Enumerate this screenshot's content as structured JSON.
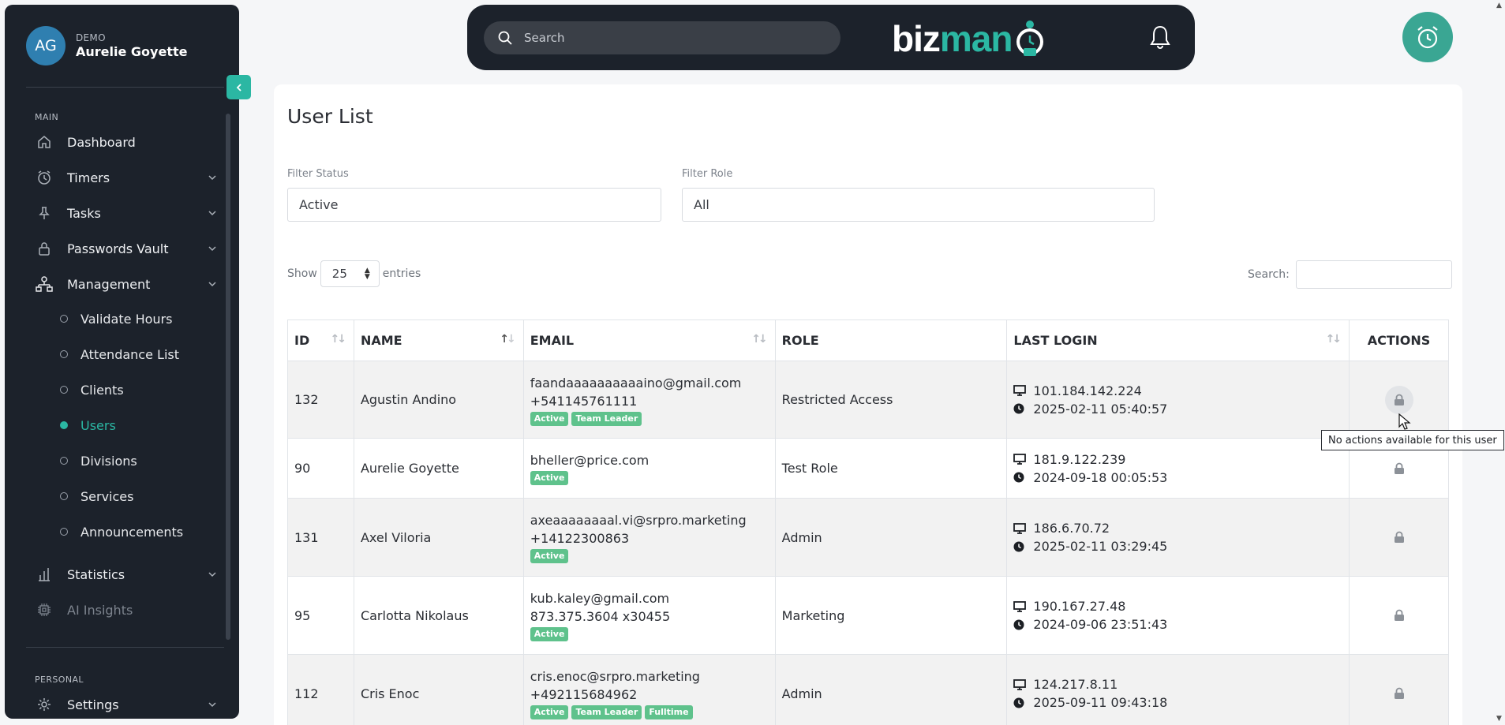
{
  "profile": {
    "initials": "AG",
    "role": "DEMO",
    "name": "Aurelie Goyette"
  },
  "sidebar": {
    "main_label": "MAIN",
    "personal_label": "PERSONAL",
    "items": [
      {
        "label": "Dashboard",
        "icon": "home-icon"
      },
      {
        "label": "Timers",
        "icon": "timer-icon"
      },
      {
        "label": "Tasks",
        "icon": "pin-icon"
      },
      {
        "label": "Passwords Vault",
        "icon": "lock-icon"
      },
      {
        "label": "Management",
        "icon": "org-chart-icon"
      },
      {
        "label": "Statistics",
        "icon": "bar-chart-icon"
      },
      {
        "label": "AI Insights",
        "icon": "chip-icon"
      },
      {
        "label": "Settings",
        "icon": "gear-icon"
      }
    ],
    "management_sub": [
      {
        "label": "Validate Hours"
      },
      {
        "label": "Attendance List"
      },
      {
        "label": "Clients"
      },
      {
        "label": "Users",
        "active": true
      },
      {
        "label": "Divisions"
      },
      {
        "label": "Services"
      },
      {
        "label": "Announcements"
      }
    ]
  },
  "topbar": {
    "search_placeholder": "Search",
    "logo_biz": "biz",
    "logo_man": "man"
  },
  "page": {
    "title": "User List",
    "filter_status_label": "Filter Status",
    "filter_status_value": "Active",
    "filter_role_label": "Filter Role",
    "filter_role_value": "All",
    "show_label": "Show",
    "entries_value": "25",
    "entries_label": "entries",
    "search_label": "Search:"
  },
  "table": {
    "headers": [
      "ID",
      "NAME",
      "EMAIL",
      "ROLE",
      "LAST LOGIN",
      "ACTIONS"
    ],
    "rows": [
      {
        "id": "132",
        "name": "Agustin Andino",
        "email": "faandaaaaaaaaaaino@gmail.com",
        "phone": "+541145761111",
        "badges": [
          "Active",
          "Team Leader"
        ],
        "role": "Restricted Access",
        "ip": "101.184.142.224",
        "login": "2025-02-11 05:40:57"
      },
      {
        "id": "90",
        "name": "Aurelie Goyette",
        "email": "bheller@price.com",
        "phone": "",
        "badges": [
          "Active"
        ],
        "role": "Test Role",
        "ip": "181.9.122.239",
        "login": "2024-09-18 00:05:53"
      },
      {
        "id": "131",
        "name": "Axel Viloria",
        "email": "axeaaaaaaaal.vi@srpro.marketing",
        "phone": "+14122300863",
        "badges": [
          "Active"
        ],
        "role": "Admin",
        "ip": "186.6.70.72",
        "login": "2025-02-11 03:29:45"
      },
      {
        "id": "95",
        "name": "Carlotta Nikolaus",
        "email": "kub.kaley@gmail.com",
        "phone": "873.375.3604 x30455",
        "badges": [
          "Active"
        ],
        "role": "Marketing",
        "ip": "190.167.27.48",
        "login": "2024-09-06 23:51:43"
      },
      {
        "id": "112",
        "name": "Cris Enoc",
        "email": "cris.enoc@srpro.marketing",
        "phone": "+492115684962",
        "badges": [
          "Active",
          "Team Leader",
          "Fulltime"
        ],
        "role": "Admin",
        "ip": "124.217.8.11",
        "login": "2025-09-11 09:43:18"
      }
    ]
  },
  "tooltip": "No actions available for this user",
  "colors": {
    "accent": "#2bb7a3",
    "sidebar_bg": "#1c222b",
    "badge": "#5fc28c"
  }
}
